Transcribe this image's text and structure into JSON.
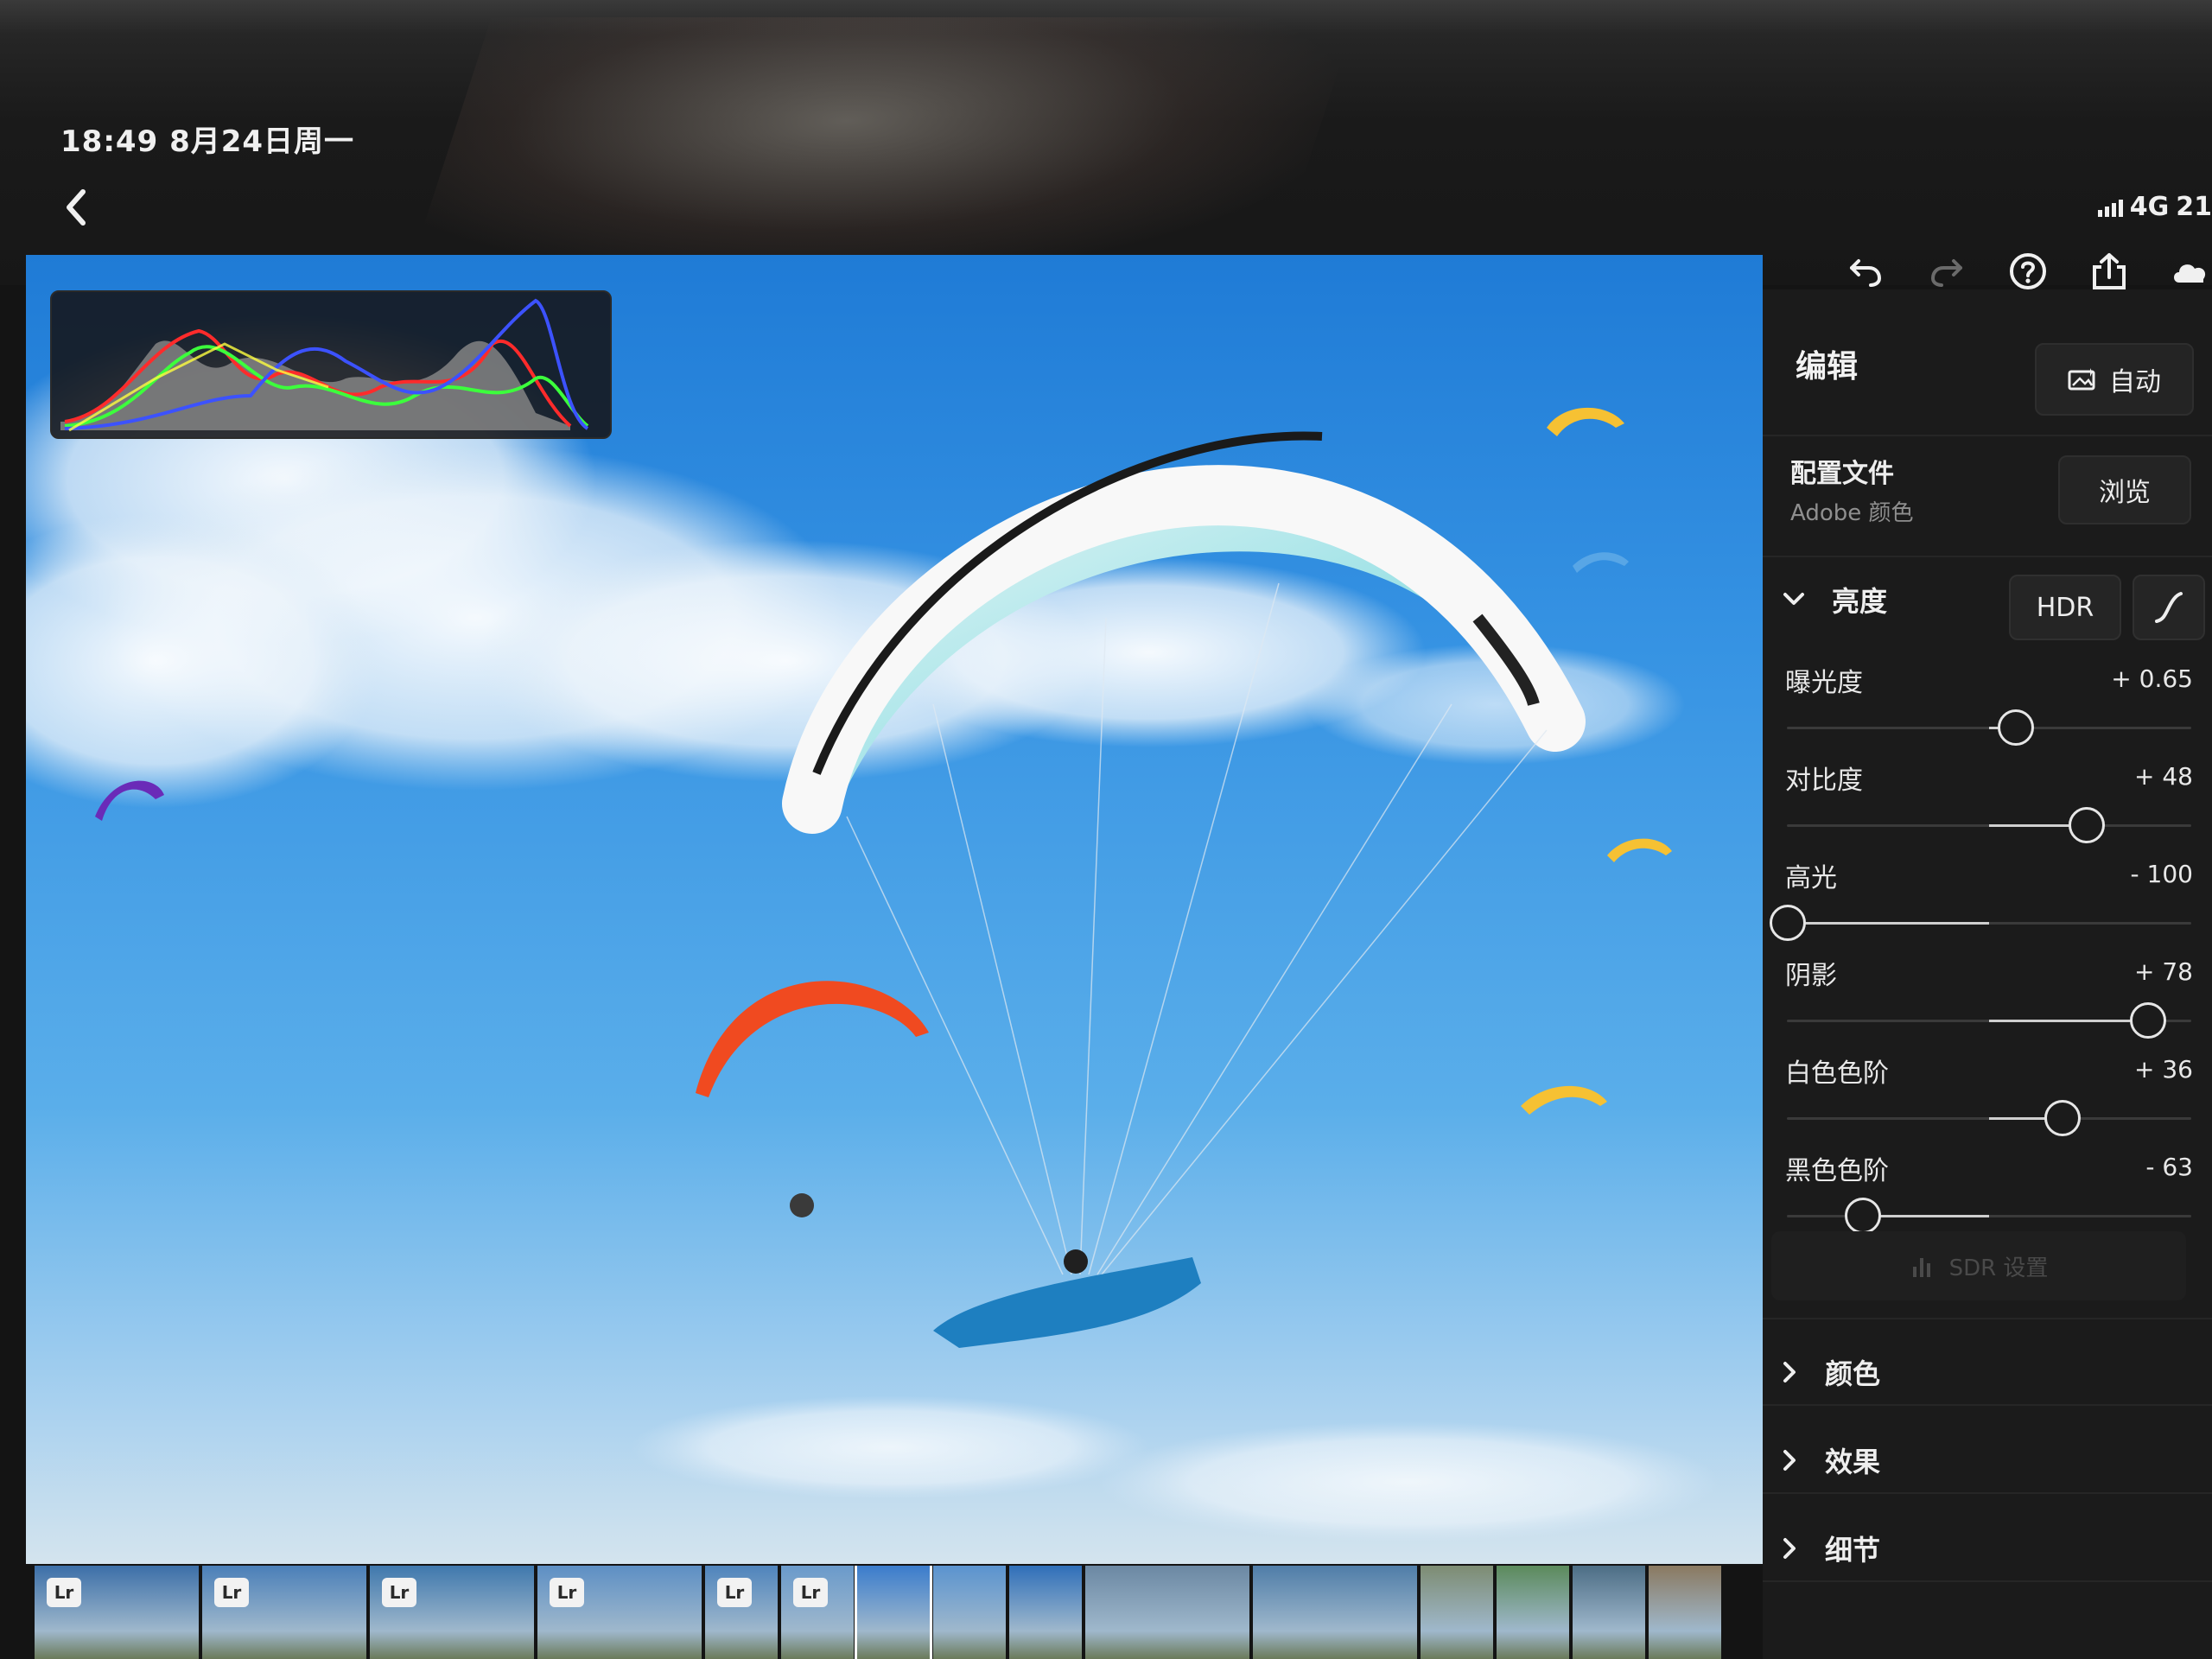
{
  "status_bar": {
    "time_date": "18:49  8月24日周一",
    "network": "4G",
    "battery": "21"
  },
  "toolbar": {
    "back_icon": "chevron-left-icon",
    "icons": [
      "undo-icon",
      "redo-icon",
      "help-icon",
      "share-icon",
      "cloud-icon"
    ]
  },
  "panel": {
    "title": "编辑",
    "auto_label": "自动",
    "profile_label": "配置文件",
    "profile_value": "Adobe 颜色",
    "browse_label": "浏览",
    "light_section": {
      "title": "亮度",
      "hdr_label": "HDR",
      "sliders": [
        {
          "label": "曝光度",
          "value": "+ 0.65",
          "level": 0.565
        },
        {
          "label": "对比度",
          "value": "+ 48",
          "level": 0.74
        },
        {
          "label": "高光",
          "value": "- 100",
          "level": 0.0
        },
        {
          "label": "阴影",
          "value": "+ 78",
          "level": 0.89
        },
        {
          "label": "白色色阶",
          "value": "+ 36",
          "level": 0.68
        },
        {
          "label": "黑色色阶",
          "value": "- 63",
          "level": 0.185
        }
      ],
      "sdr_label": "SDR 设置"
    },
    "collapsed_sections": [
      "颜色",
      "效果",
      "细节"
    ]
  },
  "filmstrip": {
    "badge_label": "Lr",
    "thumbnails": [
      {
        "badge": true,
        "tone": "#3c6fa8"
      },
      {
        "badge": true,
        "tone": "#4a7fb8"
      },
      {
        "badge": true,
        "tone": "#3f78ad"
      },
      {
        "badge": true,
        "tone": "#5d8fc4"
      },
      {
        "badge": true,
        "tone": "#4f84bc"
      },
      {
        "badge": true,
        "tone": "#6a9acb"
      },
      {
        "badge": false,
        "tone": "#3a7ccc",
        "selected": true
      },
      {
        "badge": false,
        "tone": "#5a93cf"
      },
      {
        "badge": false,
        "tone": "#2f6fb9"
      },
      {
        "badge": false,
        "tone": "#6b88a3"
      },
      {
        "badge": false,
        "tone": "#4f7da8"
      },
      {
        "badge": false,
        "tone": "#7d8c72"
      },
      {
        "badge": false,
        "tone": "#5b8a5b"
      },
      {
        "badge": false,
        "tone": "#4c6d85"
      },
      {
        "badge": false,
        "tone": "#8a7960"
      }
    ]
  },
  "colors": {
    "panel_bg": "#1b1b1b",
    "accent": "#e6e6e6"
  }
}
